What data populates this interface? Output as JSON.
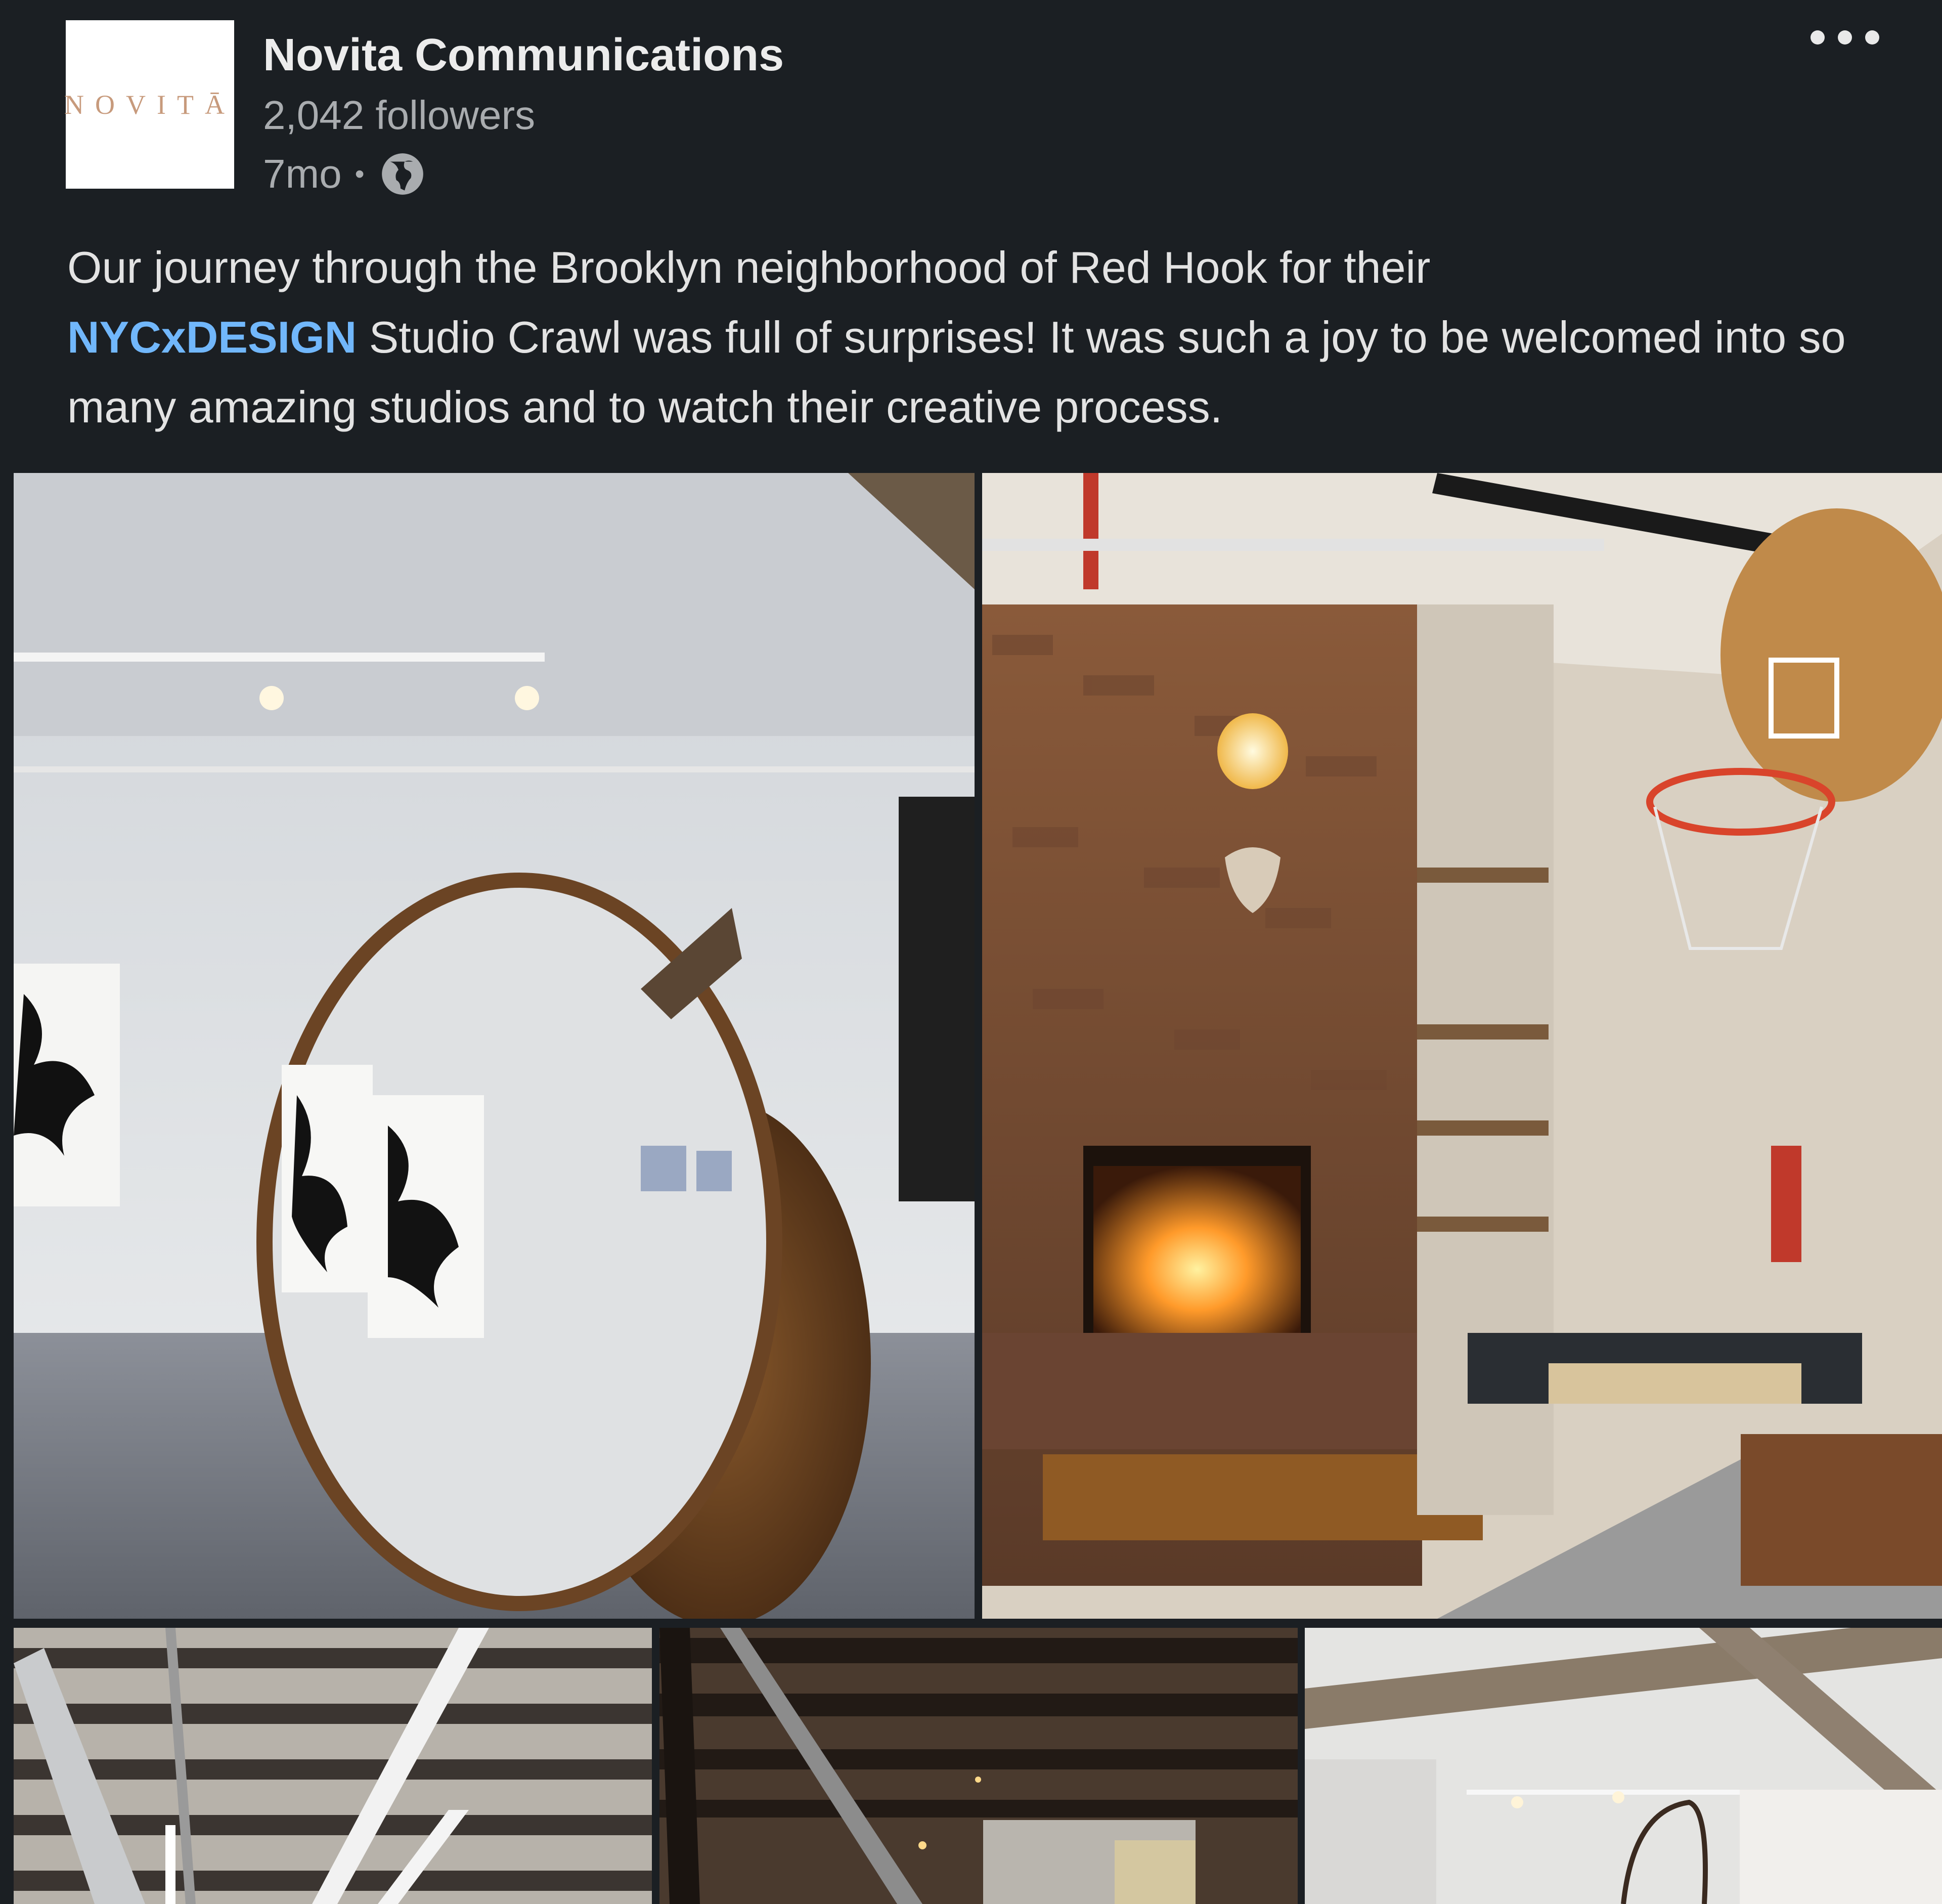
{
  "post": {
    "company_name": "Novita Communications",
    "logo_text": "NOVITĀ",
    "followers": "2,042 followers",
    "age": "7mo",
    "separator": "•",
    "visibility_icon": "globe-icon",
    "more_icon": "more-dots-icon",
    "caption_before": "Our journey through the Brooklyn neighborhood of Red Hook for their",
    "hashtag": "NYCxDESIGN",
    "caption_after": " Studio Crawl was full of surprises! It was such a joy to be welcomed into so many amazing studios and to watch their creative process.",
    "colors": {
      "background": "#1b1f23",
      "link": "#71b7fb",
      "logo_text": "#c79a7c"
    }
  },
  "photos": [
    {
      "name": "gallery-mirror-sculpture-photo"
    },
    {
      "name": "studio-fireplace-photo"
    },
    {
      "name": "studio-ceiling-photo"
    },
    {
      "name": "dark-beam-ceiling-photo"
    },
    {
      "name": "gallery-hoop-photo"
    }
  ]
}
